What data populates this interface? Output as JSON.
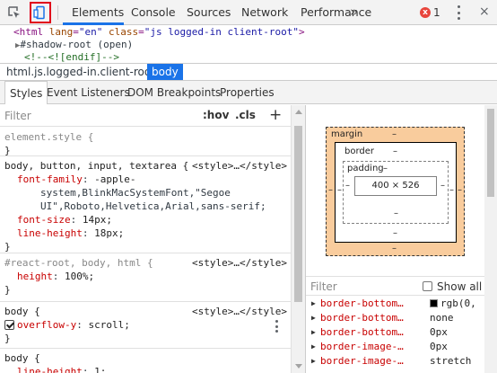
{
  "toolbar": {
    "inspect_icon": "inspect-element-icon",
    "device_icon": "device-toggle-icon",
    "tabs": [
      "Elements",
      "Console",
      "Sources",
      "Network",
      "Performance"
    ],
    "more_tabs": "»",
    "error_count": "1",
    "error_icon": "x",
    "close": "×"
  },
  "dom": {
    "line1": {
      "open": "<html lang=\"en\" class=\"js logged-in client-root\">",
      "tag_open": "<html",
      "lang_name": " lang",
      "lang_val": "\"en\"",
      "class_name": " class",
      "class_val": "\"js logged-in client-root\"",
      "tag_close": ">"
    },
    "line2": "#shadow-root (open)",
    "line3": "<!--<![endif]-->"
  },
  "breadcrumb": {
    "items": [
      "html.js.logged-in.client-root",
      "body"
    ]
  },
  "subtabs": [
    "Styles",
    "Event Listeners",
    "DOM Breakpoints",
    "Properties"
  ],
  "styles": {
    "filter_placeholder": "Filter",
    "hov": ":hov",
    "cls": ".cls",
    "add": "+",
    "rules": [
      {
        "selector": "element.style {",
        "source": "",
        "decls": [],
        "close": "}"
      },
      {
        "selector": "body, button, input, textarea {",
        "source": "<style>…</style>",
        "decls": [
          {
            "prop": "font-family",
            "val": "-apple-"
          },
          {
            "cont": "system,BlinkMacSystemFont,\"Segoe"
          },
          {
            "cont": "UI\",Roboto,Helvetica,Arial,sans-serif;"
          },
          {
            "prop": "font-size",
            "val": "14px;"
          },
          {
            "prop": "line-height",
            "val": "18px;"
          }
        ],
        "close": "}"
      },
      {
        "selector": "#react-root, body, html {",
        "source": "<style>…</style>",
        "decls": [
          {
            "prop": "height",
            "val": "100%;"
          }
        ],
        "close": "}"
      },
      {
        "selector": "body {",
        "source": "<style>…</style>",
        "decls": [
          {
            "prop": "overflow-y",
            "val": "scroll;"
          }
        ],
        "close": "}"
      },
      {
        "selector": "body {",
        "source": "",
        "decls": [
          {
            "prop": "line-height",
            "val": "1;"
          }
        ],
        "close": ""
      }
    ]
  },
  "boxmodel": {
    "margin_label": "margin",
    "border_label": "border",
    "padding_label": "padding",
    "content_size": "400 × 526",
    "dash": "–"
  },
  "computed": {
    "filter_placeholder": "Filter",
    "show_all": "Show all",
    "props": [
      {
        "name": "border-bottom…",
        "val": "rgb(0,",
        "swatch": "#000000"
      },
      {
        "name": "border-bottom…",
        "val": "none"
      },
      {
        "name": "border-bottom…",
        "val": "0px"
      },
      {
        "name": "border-image-…",
        "val": "0px"
      },
      {
        "name": "border-image-…",
        "val": "stretch"
      }
    ]
  }
}
